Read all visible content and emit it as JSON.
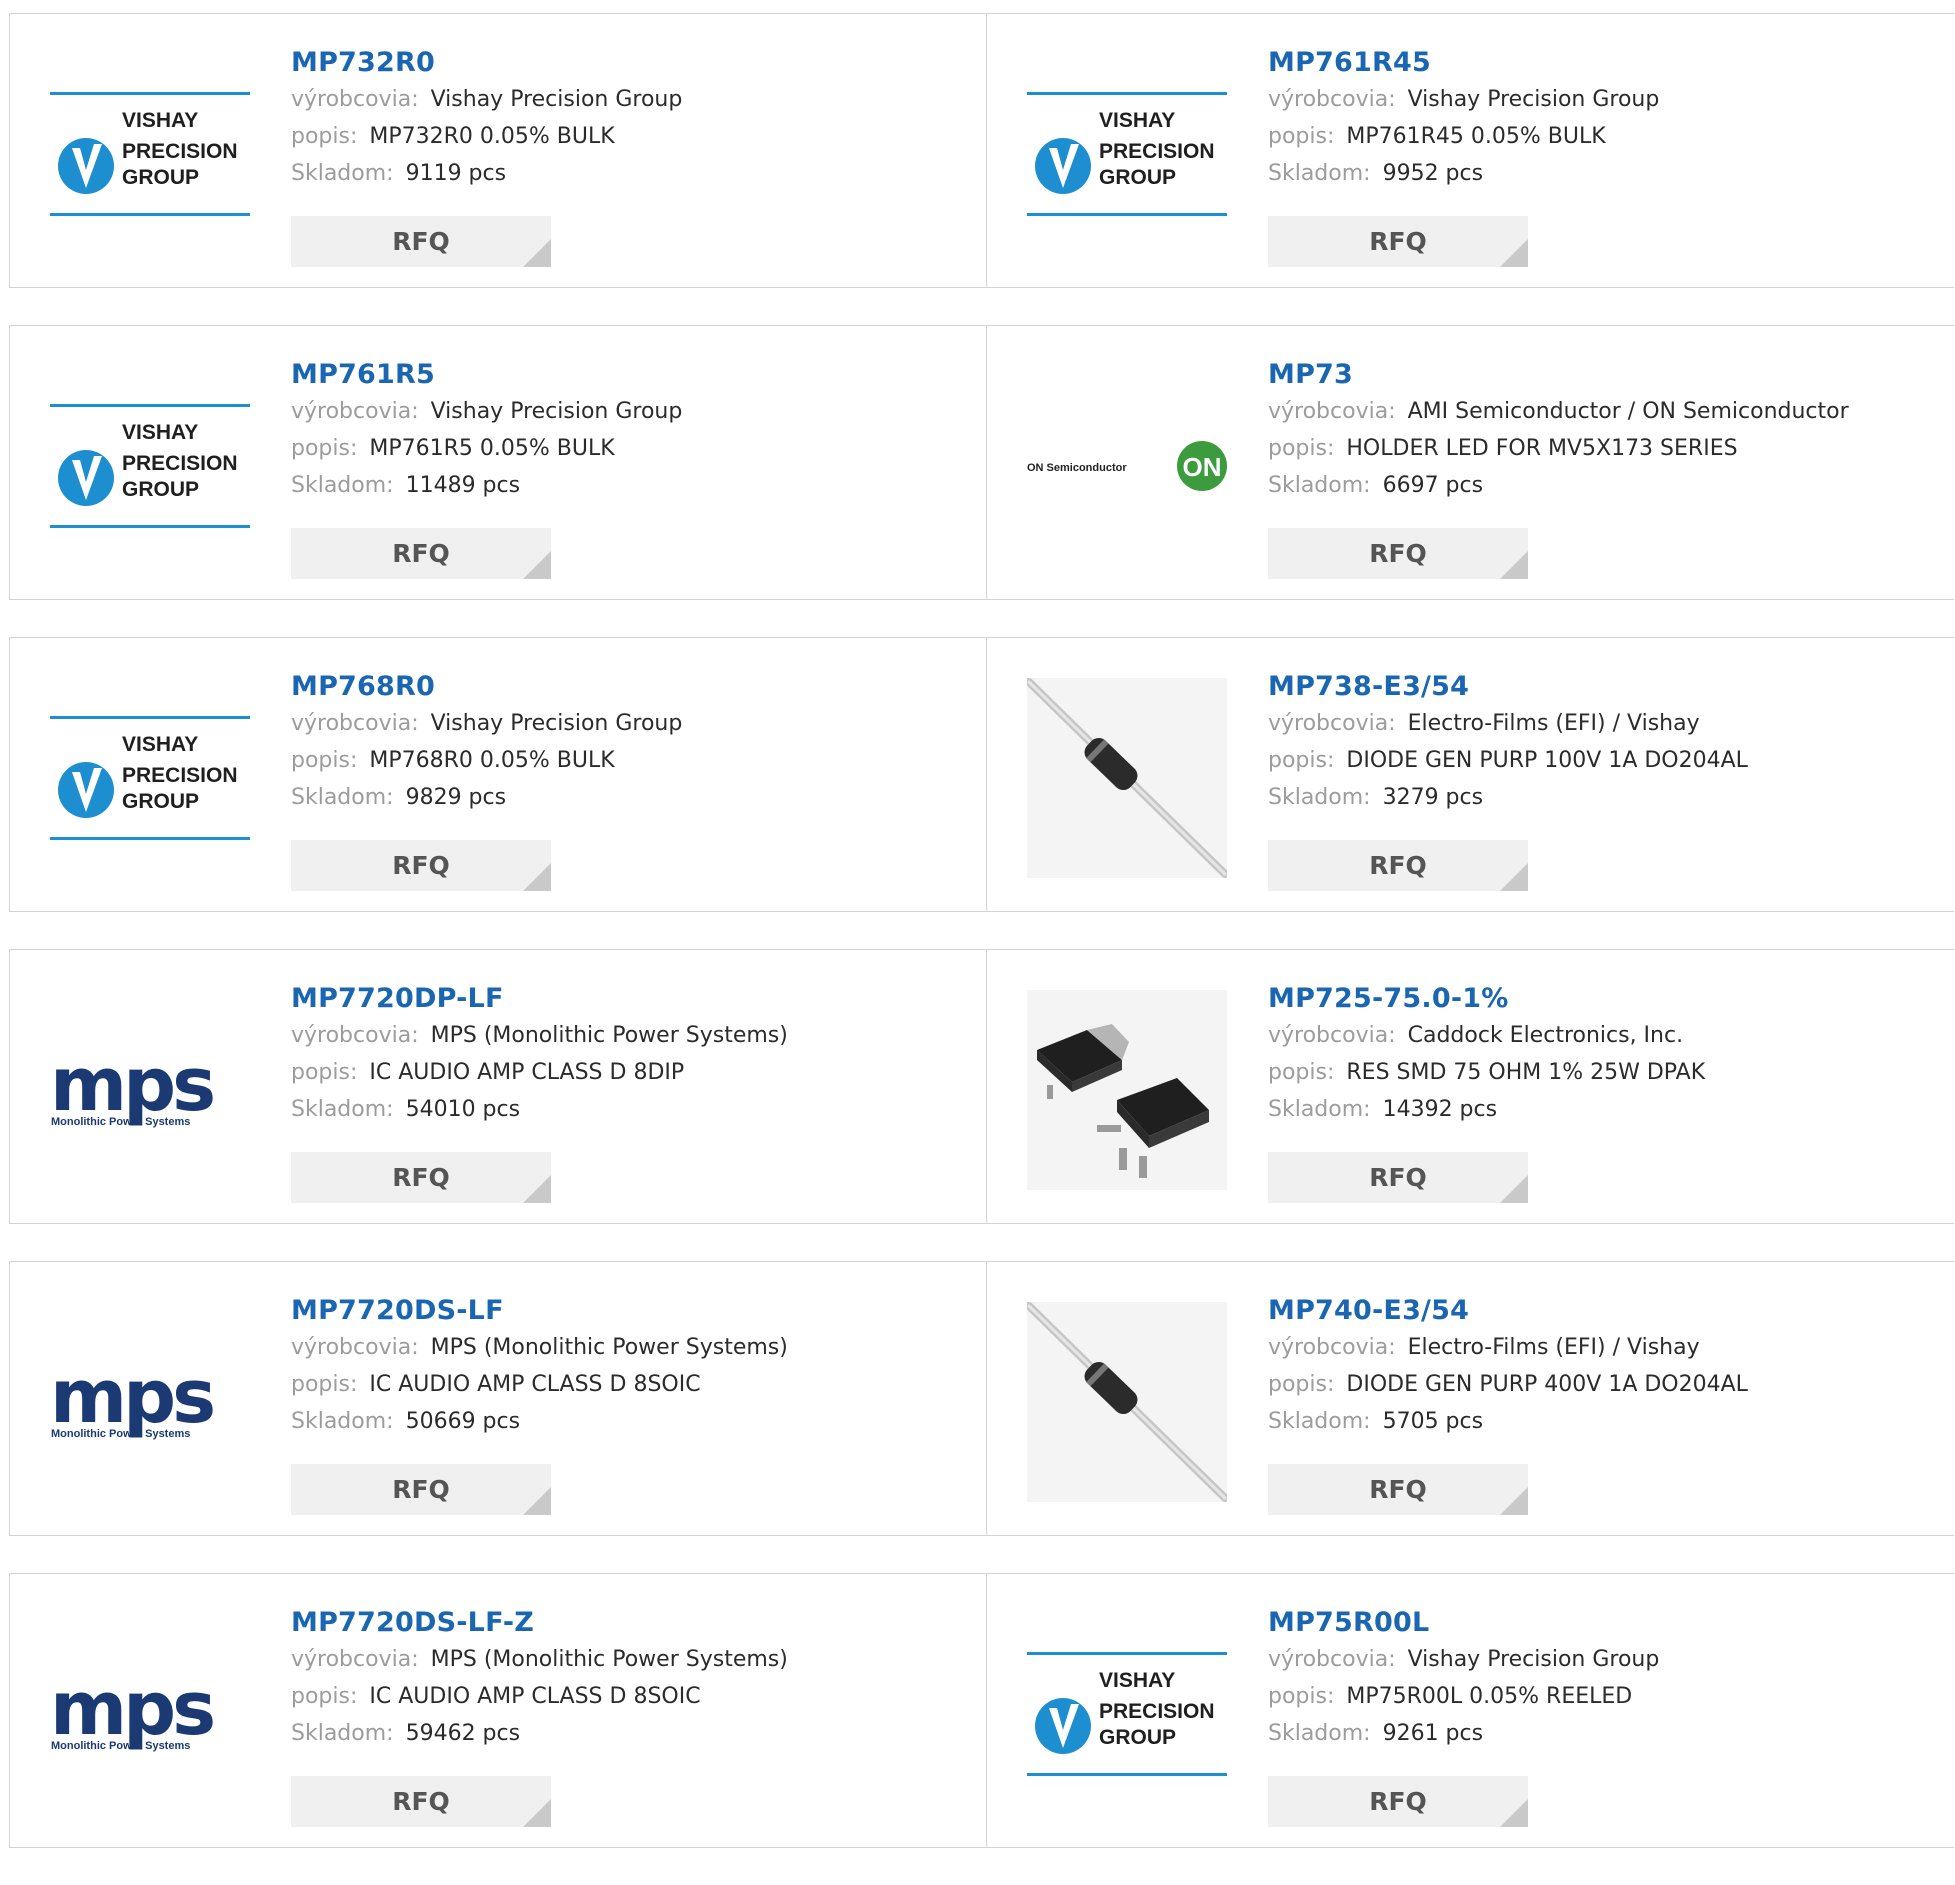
{
  "labels": {
    "manufacturer": "výrobcovia:",
    "description": "popis:",
    "stock": "Skladom:",
    "rfq": "RFQ"
  },
  "brand_logos": {
    "vishay": {
      "line1": "VISHAY",
      "line2": "PRECISION",
      "line3": "GROUP",
      "accent": "#1d8fd1"
    },
    "onsemi": {
      "text": "ON Semiconductor",
      "badge": "ON",
      "accent": "#3c9b3c"
    },
    "mps": {
      "big": "mps",
      "small": "Monolithic Power Systems",
      "accent": "#1b3a73"
    }
  },
  "colors": {
    "part_number": "#1a66b0",
    "label": "#9c9c9c",
    "value": "#2b2b2b",
    "rfq_bg": "#f0f0f0",
    "border": "#d4d4d4"
  },
  "products": [
    {
      "part_number": "MP732R0",
      "manufacturer": "Vishay Precision Group",
      "description": "MP732R0 0.05% BULK",
      "stock": "9119 pcs",
      "logo": "vishay"
    },
    {
      "part_number": "MP761R45",
      "manufacturer": "Vishay Precision Group",
      "description": "MP761R45 0.05% BULK",
      "stock": "9952 pcs",
      "logo": "vishay"
    },
    {
      "part_number": "MP761R5",
      "manufacturer": "Vishay Precision Group",
      "description": "MP761R5 0.05% BULK",
      "stock": "11489 pcs",
      "logo": "vishay"
    },
    {
      "part_number": "MP73",
      "manufacturer": "AMI Semiconductor / ON Semiconductor",
      "description": "HOLDER LED FOR MV5X173 SERIES",
      "stock": "6697 pcs",
      "logo": "onsemi"
    },
    {
      "part_number": "MP768R0",
      "manufacturer": "Vishay Precision Group",
      "description": "MP768R0 0.05% BULK",
      "stock": "9829 pcs",
      "logo": "vishay"
    },
    {
      "part_number": "MP738-E3/54",
      "manufacturer": "Electro-Films (EFI) / Vishay",
      "description": "DIODE GEN PURP 100V 1A DO204AL",
      "stock": "3279 pcs",
      "logo": "diode"
    },
    {
      "part_number": "MP7720DP-LF",
      "manufacturer": "MPS (Monolithic Power Systems)",
      "description": "IC AUDIO AMP CLASS D 8DIP",
      "stock": "54010 pcs",
      "logo": "mps"
    },
    {
      "part_number": "MP725-75.0-1%",
      "manufacturer": "Caddock Electronics, Inc.",
      "description": "RES SMD 75 OHM 1% 25W DPAK",
      "stock": "14392 pcs",
      "logo": "dpak"
    },
    {
      "part_number": "MP7720DS-LF",
      "manufacturer": "MPS (Monolithic Power Systems)",
      "description": "IC AUDIO AMP CLASS D 8SOIC",
      "stock": "50669 pcs",
      "logo": "mps"
    },
    {
      "part_number": "MP740-E3/54",
      "manufacturer": "Electro-Films (EFI) / Vishay",
      "description": "DIODE GEN PURP 400V 1A DO204AL",
      "stock": "5705 pcs",
      "logo": "diode"
    },
    {
      "part_number": "MP7720DS-LF-Z",
      "manufacturer": "MPS (Monolithic Power Systems)",
      "description": "IC AUDIO AMP CLASS D 8SOIC",
      "stock": "59462 pcs",
      "logo": "mps"
    },
    {
      "part_number": "MP75R00L",
      "manufacturer": "Vishay Precision Group",
      "description": "MP75R00L 0.05% REELED",
      "stock": "9261 pcs",
      "logo": "vishay"
    }
  ]
}
